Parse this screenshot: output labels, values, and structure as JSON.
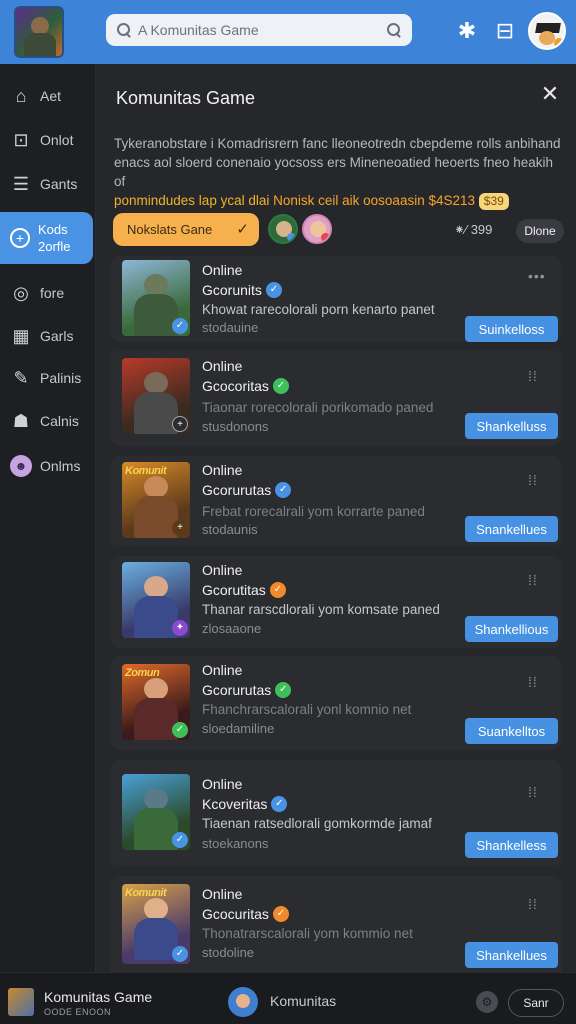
{
  "header": {
    "search_placeholder": "A Komunitas Game"
  },
  "sidebar": {
    "items": [
      {
        "label": "Aet",
        "icon": "home-icon"
      },
      {
        "label": "Onlot",
        "icon": "inbox-icon"
      },
      {
        "label": "Gants",
        "icon": "list-icon"
      },
      {
        "label": "Kods",
        "label2": "2orfle",
        "icon": "plus-circle-icon",
        "active": true
      },
      {
        "label": "fore",
        "icon": "headset-icon"
      },
      {
        "label": "Garls",
        "icon": "grid-icon"
      },
      {
        "label": "Palinis",
        "icon": "brush-icon"
      },
      {
        "label": "Calnis",
        "icon": "people-icon"
      },
      {
        "label": "Onlms",
        "icon": "avatar-icon"
      }
    ]
  },
  "panel": {
    "title": "Komunitas Game",
    "desc_line1": "Tykeranobstare i Komadrisrern fanc lleoneotredn cbepdeme rolls anbihand",
    "desc_line2": "enacs aol sloerd conenaio yocsoss ers Mineneoatied heoerts fneo heakih of",
    "desc_line3_a": "ponmindudes lap ycal dlai",
    "desc_line3_b": "Nonisk ceil aik oosoaasin $4S213",
    "desc_badge": "$39",
    "chip_label": "Nokslats Gane",
    "count": "399",
    "done_label": "Dlone"
  },
  "cards": [
    {
      "status": "Online",
      "name": "Gcorunits",
      "desc": "Khowat rarecolorali porn kenarto panet",
      "sub": "stodauine",
      "button": "Suinkelloss",
      "desc_dim": false,
      "badge_color": "#4a93e4"
    },
    {
      "status": "Online",
      "name": "Gcocoritas",
      "desc": "Tiaonar rorecolorali porikomado paned",
      "sub": "stusdonons",
      "button": "Shankelluss",
      "desc_dim": true,
      "badge_color": "#3fbf5a"
    },
    {
      "status": "Online",
      "name": "Gcorurutas",
      "desc": "Frebat rorecalrali yom korrarte paned",
      "sub": "stodaunis",
      "button": "Snankellues",
      "desc_dim": true,
      "badge_color": "#4a93e4",
      "thumb_title": "Komunit"
    },
    {
      "status": "Online",
      "name": "Gcorutitas",
      "desc": "Thanar rarscdlorali yom komsate paned",
      "sub": "zlosaaone",
      "button": "Shankellious",
      "desc_dim": false,
      "badge_color": "#f08a2a"
    },
    {
      "status": "Online",
      "name": "Gcorurutas",
      "desc": "Fhanchrarscalorali yonl komnio net",
      "sub": "sloedamiline",
      "button": "Suankelltos",
      "desc_dim": true,
      "badge_color": "#3fbf5a",
      "thumb_title": "Zomun"
    },
    {
      "status": "Online",
      "name": "Kcoveritas",
      "desc": "Tiaenan ratsedlorali gomkormde jamaf",
      "sub": "stoekanons",
      "button": "Shankelless",
      "desc_dim": false,
      "badge_color": "#4a93e4"
    },
    {
      "status": "Online",
      "name": "Gcocuritas",
      "desc": "Thonatrarscalorali yom kommio net",
      "sub": "stodoline",
      "button": "Shankellues",
      "desc_dim": true,
      "badge_color": "#f08a2a",
      "thumb_title": "Komunit"
    }
  ],
  "bottombar": {
    "title": "Komunitas Game",
    "subtitle": "OODE ENOON",
    "label": "Komunitas",
    "button": "Sanr"
  },
  "colors": {
    "accent": "#3d84d8",
    "button": "#4691e2",
    "chip": "#f6b14e",
    "highlight": "#f0b429"
  }
}
